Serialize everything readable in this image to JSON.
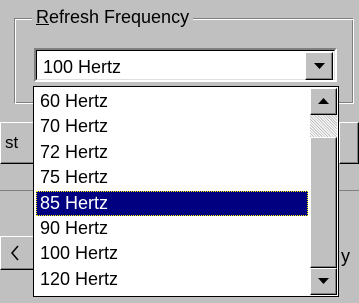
{
  "group": {
    "title_accel": "R",
    "title_rest": "efresh Frequency"
  },
  "combo": {
    "value": "100 Hertz"
  },
  "background": {
    "left_button_text": "st",
    "right_fragment_text": "y"
  },
  "list": {
    "items": [
      "60 Hertz",
      "70 Hertz",
      "72 Hertz",
      "75 Hertz",
      "85 Hertz",
      "90 Hertz",
      "100 Hertz",
      "120 Hertz"
    ],
    "selected": "85 Hertz"
  },
  "colors": {
    "window": "#c0c0c0",
    "selection": "#000080"
  },
  "icons": {
    "combo_button": "triangle-down-icon",
    "scroll_up": "triangle-up-icon",
    "scroll_down": "triangle-down-icon",
    "background_arrow": "chevron-left-icon"
  }
}
